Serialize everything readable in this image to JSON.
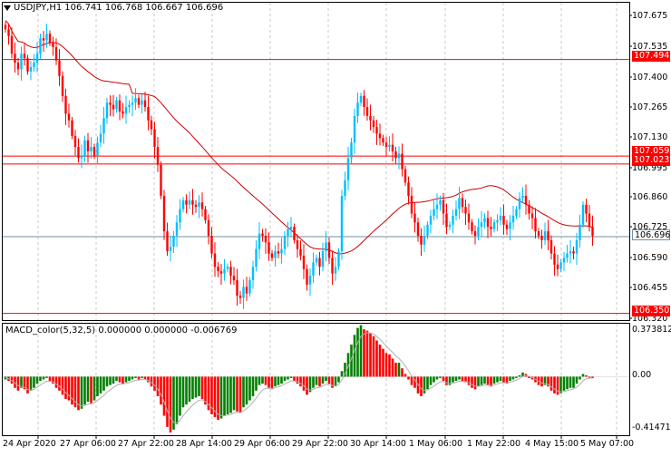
{
  "header": {
    "symbol": "USDJPY,H1",
    "values": "106.741 106.768 106.667 106.696"
  },
  "macd": {
    "title": "MACD_color(5,32,5) 0.000000 0.000000 -0.006769",
    "axis_labels": [
      "0.373812",
      "0.00",
      "-0.414713"
    ]
  },
  "price_axis": [
    "107.675",
    "107.535",
    "107.400",
    "107.265",
    "107.130",
    "106.995",
    "106.860",
    "106.725",
    "106.590",
    "106.455",
    "106.320"
  ],
  "hlines": [
    {
      "label": "107.494",
      "price": 107.494,
      "color": "#ff0000"
    },
    {
      "label": "107.059",
      "price": 107.059,
      "color": "#ff0000"
    },
    {
      "label": "107.023",
      "price": 107.023,
      "color": "#ff0000"
    },
    {
      "label": "106.696",
      "price": 106.696,
      "color": "#6f8fa5"
    },
    {
      "label": "106.350",
      "price": 106.35,
      "color": "#ff0000"
    }
  ],
  "time_axis": [
    "24 Apr 2020",
    "27 Apr 06:00",
    "27 Apr 22:00",
    "28 Apr 14:00",
    "29 Apr 06:00",
    "29 Apr 22:00",
    "30 Apr 14:00",
    "1 May 06:00",
    "1 May 22:00",
    "4 May 15:00",
    "5 May 07:00"
  ],
  "colors": {
    "bull": "#00bfff",
    "bear": "#ff0000",
    "hist_up": "#008000",
    "hist_down": "#ff0000",
    "ma": "#cc0000",
    "signal": "#b0b0b0"
  },
  "chart_data": {
    "type": "candlestick",
    "price_range": [
      106.32,
      107.75
    ],
    "macd_range": [
      -0.42,
      0.38
    ],
    "closes": [
      107.63,
      107.6,
      107.52,
      107.48,
      107.45,
      107.52,
      107.5,
      107.44,
      107.46,
      107.48,
      107.52,
      107.59,
      107.58,
      107.61,
      107.57,
      107.55,
      107.49,
      107.42,
      107.33,
      107.25,
      107.22,
      107.15,
      107.1,
      107.05,
      107.06,
      107.13,
      107.08,
      107.1,
      107.06,
      107.12,
      107.16,
      107.23,
      107.3,
      107.29,
      107.27,
      107.31,
      107.26,
      107.25,
      107.28,
      107.29,
      107.3,
      107.32,
      107.29,
      107.31,
      107.28,
      107.22,
      107.18,
      107.1,
      107.02,
      106.88,
      106.72,
      106.63,
      106.65,
      106.7,
      106.76,
      106.82,
      106.86,
      106.84,
      106.86,
      106.84,
      106.83,
      106.85,
      106.82,
      106.77,
      106.7,
      106.62,
      106.56,
      106.54,
      106.53,
      106.55,
      106.56,
      106.52,
      106.5,
      106.43,
      106.42,
      106.47,
      106.44,
      106.5,
      106.56,
      106.64,
      106.71,
      106.7,
      106.67,
      106.62,
      106.6,
      106.63,
      106.62,
      106.64,
      106.7,
      106.73,
      106.74,
      106.68,
      106.64,
      106.61,
      106.55,
      106.48,
      106.52,
      106.58,
      106.6,
      106.56,
      106.63,
      106.67,
      106.6,
      106.53,
      106.56,
      106.63,
      106.88,
      106.95,
      107.05,
      107.12,
      107.24,
      107.3,
      107.33,
      107.28,
      107.24,
      107.22,
      107.19,
      107.16,
      107.14,
      107.12,
      107.1,
      107.11,
      107.08,
      107.05,
      107.07,
      107.0,
      106.94,
      106.88,
      106.8,
      106.76,
      106.7,
      106.66,
      106.7,
      106.75,
      106.79,
      106.82,
      106.84,
      106.86,
      106.8,
      106.74,
      106.75,
      106.79,
      106.82,
      106.87,
      106.83,
      106.8,
      106.76,
      106.72,
      106.7,
      106.74,
      106.76,
      106.78,
      106.74,
      106.73,
      106.76,
      106.77,
      106.79,
      106.75,
      106.73,
      106.76,
      106.79,
      106.82,
      106.87,
      106.88,
      106.84,
      106.8,
      106.78,
      106.72,
      106.7,
      106.68,
      106.72,
      106.68,
      106.62,
      106.57,
      106.55,
      106.58,
      106.6,
      106.62,
      106.63,
      106.62,
      106.68,
      106.75,
      106.84,
      106.8,
      106.74,
      106.7
    ],
    "hist": [
      -0.02,
      -0.03,
      -0.05,
      -0.08,
      -0.1,
      -0.08,
      -0.09,
      -0.12,
      -0.1,
      -0.08,
      -0.05,
      -0.03,
      -0.02,
      -0.01,
      -0.03,
      -0.05,
      -0.08,
      -0.1,
      -0.13,
      -0.16,
      -0.17,
      -0.2,
      -0.22,
      -0.24,
      -0.23,
      -0.2,
      -0.18,
      -0.19,
      -0.17,
      -0.14,
      -0.12,
      -0.1,
      -0.07,
      -0.06,
      -0.05,
      -0.03,
      -0.04,
      -0.05,
      -0.04,
      -0.03,
      -0.02,
      -0.01,
      -0.02,
      -0.01,
      -0.02,
      -0.04,
      -0.07,
      -0.1,
      -0.14,
      -0.2,
      -0.28,
      -0.36,
      -0.4,
      -0.38,
      -0.34,
      -0.28,
      -0.22,
      -0.2,
      -0.18,
      -0.16,
      -0.15,
      -0.14,
      -0.16,
      -0.2,
      -0.24,
      -0.27,
      -0.29,
      -0.31,
      -0.3,
      -0.28,
      -0.27,
      -0.26,
      -0.24,
      -0.25,
      -0.26,
      -0.22,
      -0.2,
      -0.17,
      -0.14,
      -0.1,
      -0.06,
      -0.05,
      -0.06,
      -0.08,
      -0.09,
      -0.07,
      -0.06,
      -0.05,
      -0.03,
      -0.02,
      -0.01,
      -0.03,
      -0.05,
      -0.07,
      -0.1,
      -0.13,
      -0.11,
      -0.08,
      -0.06,
      -0.07,
      -0.05,
      -0.03,
      -0.05,
      -0.08,
      -0.07,
      -0.04,
      0.04,
      0.1,
      0.17,
      0.23,
      0.3,
      0.35,
      0.37,
      0.34,
      0.33,
      0.31,
      0.29,
      0.26,
      0.23,
      0.2,
      0.17,
      0.16,
      0.13,
      0.1,
      0.1,
      0.06,
      0.02,
      -0.02,
      -0.06,
      -0.08,
      -0.12,
      -0.14,
      -0.12,
      -0.09,
      -0.06,
      -0.04,
      -0.02,
      -0.01,
      -0.03,
      -0.06,
      -0.06,
      -0.04,
      -0.03,
      -0.02,
      -0.03,
      -0.04,
      -0.06,
      -0.08,
      -0.09,
      -0.07,
      -0.06,
      -0.05,
      -0.06,
      -0.07,
      -0.05,
      -0.04,
      -0.03,
      -0.04,
      -0.05,
      -0.03,
      -0.02,
      -0.01,
      0.01,
      0.03,
      0.02,
      -0.01,
      -0.02,
      -0.04,
      -0.06,
      -0.07,
      -0.06,
      -0.07,
      -0.1,
      -0.12,
      -0.13,
      -0.12,
      -0.1,
      -0.09,
      -0.08,
      -0.08,
      -0.05,
      -0.02,
      0.02,
      0.01,
      0.0,
      -0.01
    ]
  }
}
